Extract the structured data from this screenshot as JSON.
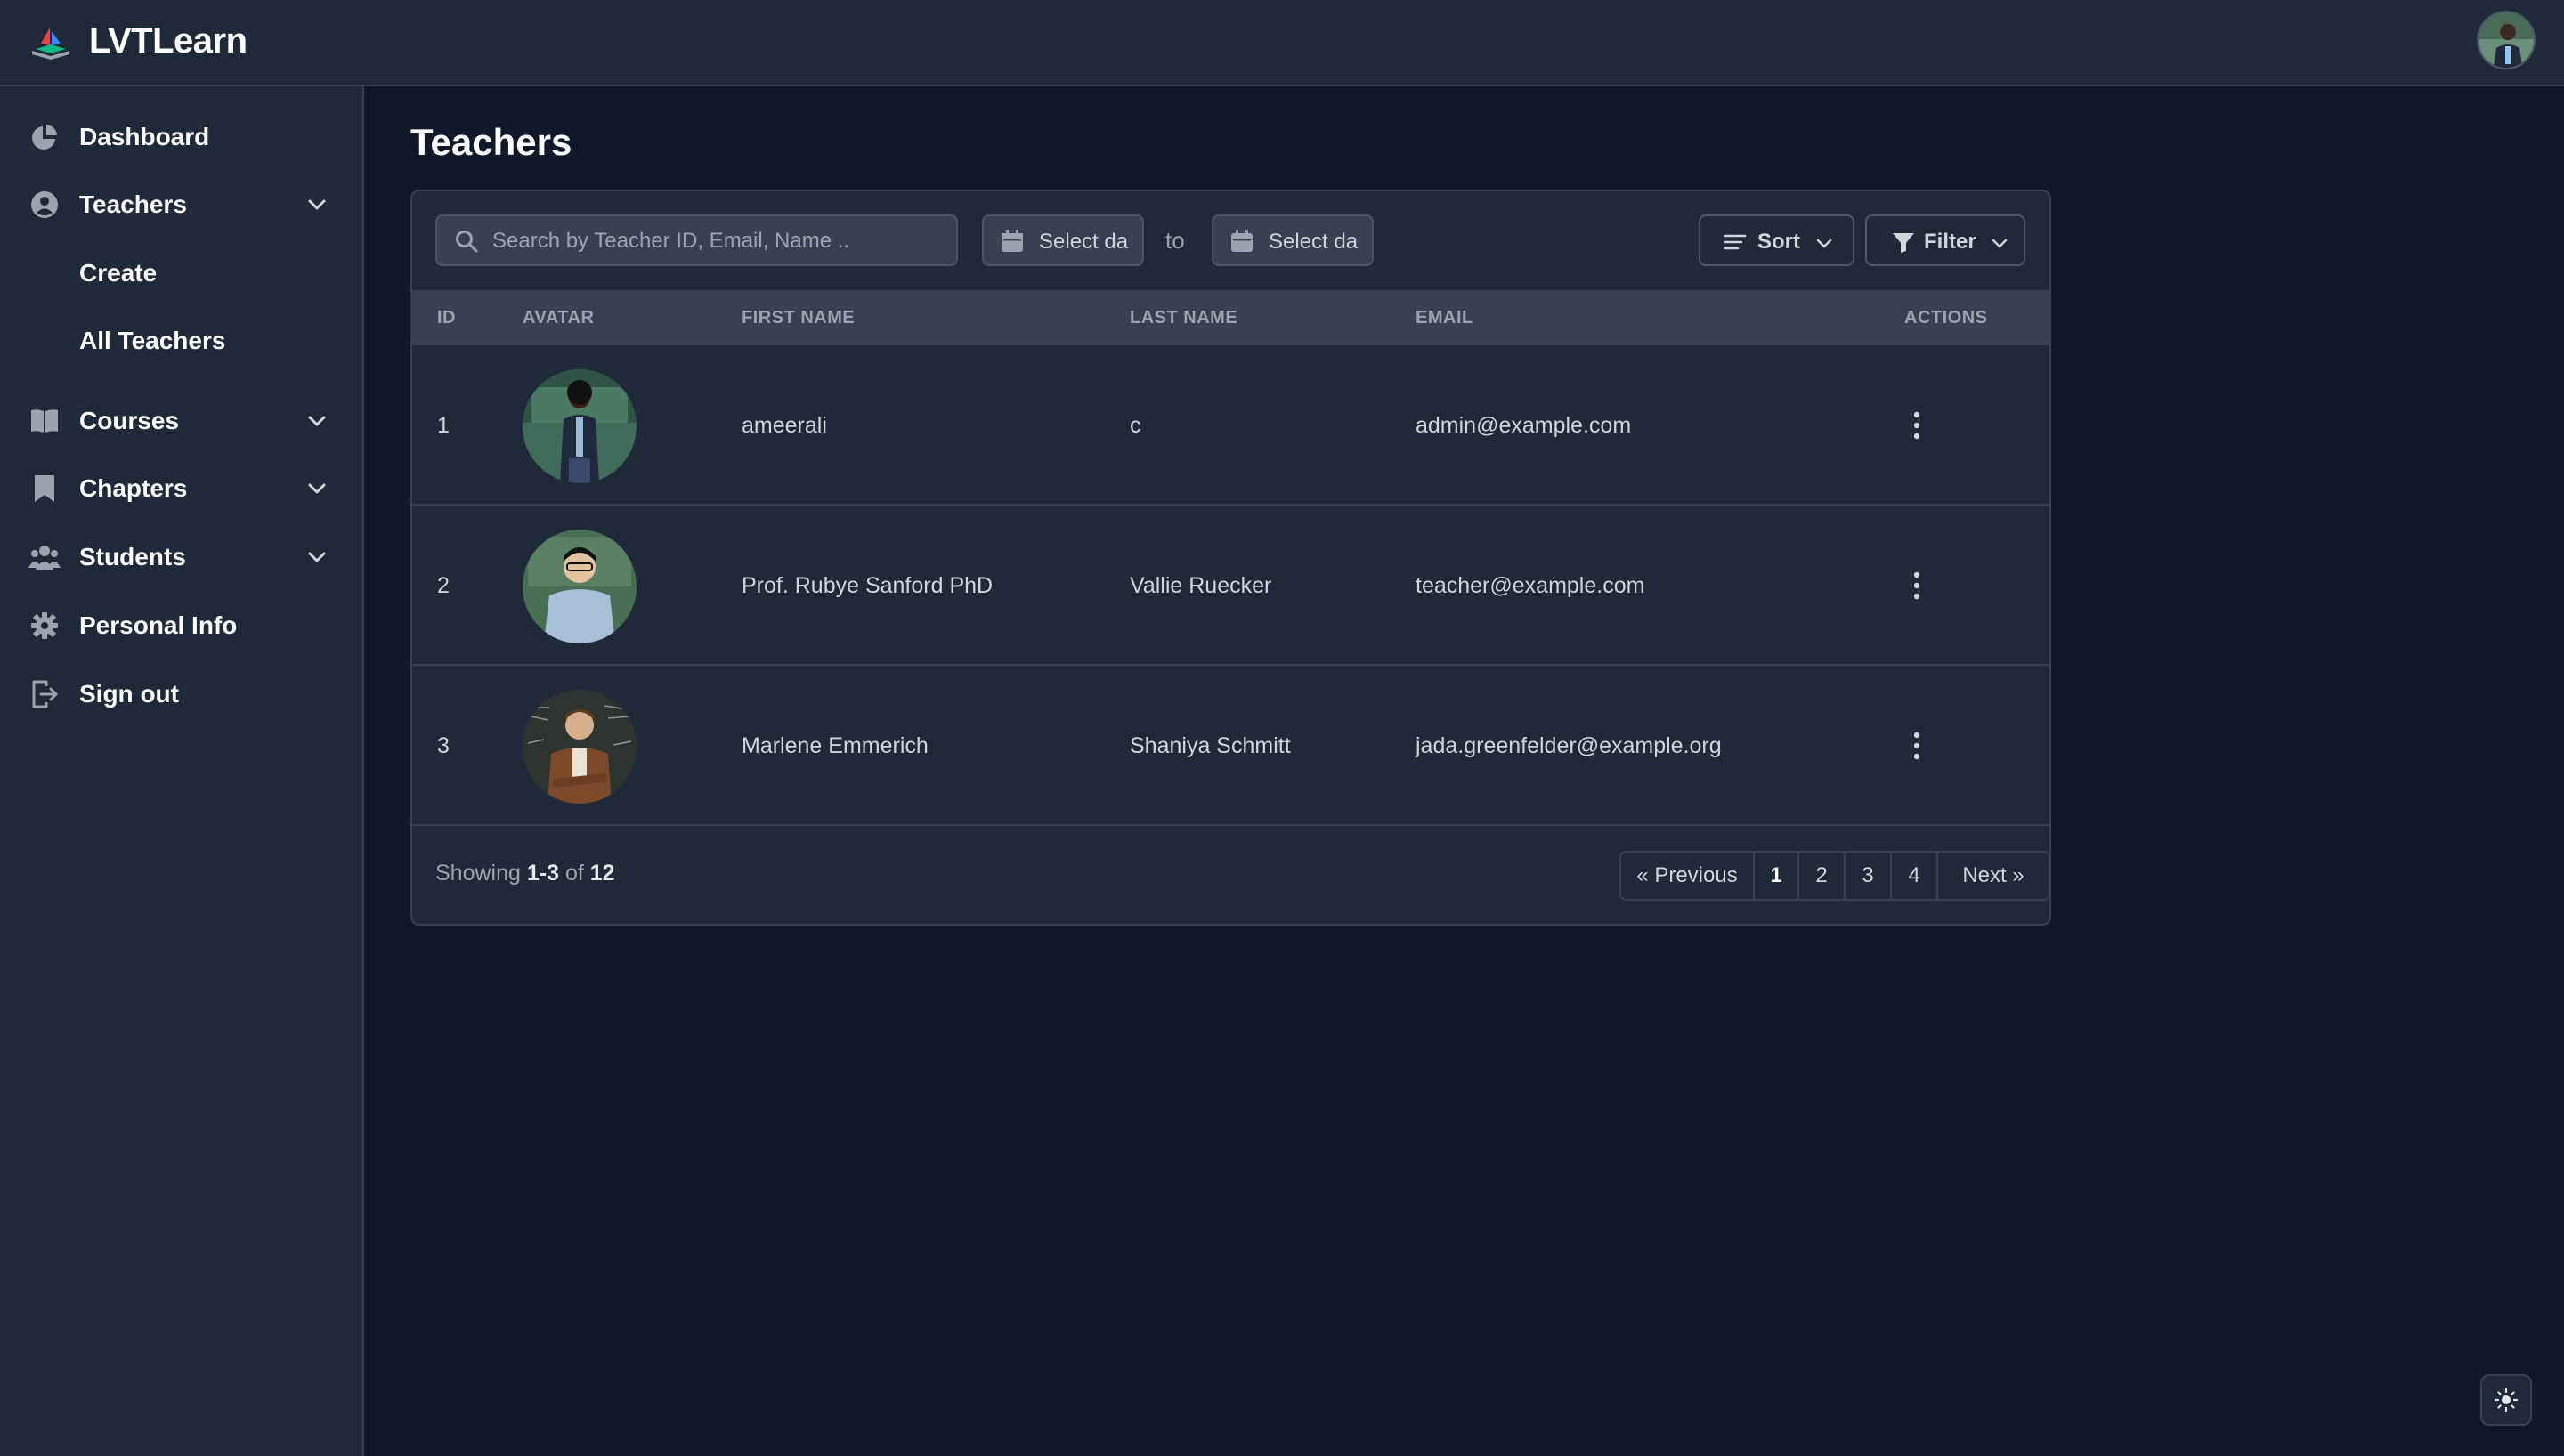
{
  "app": {
    "name": "LVTLearn"
  },
  "sidebar": {
    "items": [
      {
        "label": "Dashboard",
        "icon": "pie-chart-icon"
      },
      {
        "label": "Teachers",
        "icon": "user-circle-icon",
        "expanded": true,
        "children": [
          {
            "label": "Create"
          },
          {
            "label": "All Teachers"
          }
        ]
      },
      {
        "label": "Courses",
        "icon": "book-open-icon"
      },
      {
        "label": "Chapters",
        "icon": "bookmark-icon"
      },
      {
        "label": "Students",
        "icon": "users-icon"
      },
      {
        "label": "Personal Info",
        "icon": "gear-icon"
      },
      {
        "label": "Sign out",
        "icon": "sign-out-icon"
      }
    ]
  },
  "page": {
    "title": "Teachers"
  },
  "toolbar": {
    "search_placeholder": "Search by Teacher ID, Email, Name ..",
    "date_from": "Select da",
    "date_to": "Select da",
    "to_label": "to",
    "sort_label": "Sort",
    "filter_label": "Filter"
  },
  "table": {
    "columns": [
      "ID",
      "AVATAR",
      "FIRST NAME",
      "LAST NAME",
      "EMAIL",
      "ACTIONS"
    ],
    "rows": [
      {
        "id": "1",
        "first_name": "ameerali",
        "last_name": "c",
        "email": "admin@example.com"
      },
      {
        "id": "2",
        "first_name": "Prof. Rubye Sanford PhD",
        "last_name": "Vallie Ruecker",
        "email": "teacher@example.com"
      },
      {
        "id": "3",
        "first_name": "Marlene Emmerich",
        "last_name": "Shaniya Schmitt",
        "email": "jada.greenfelder@example.org"
      }
    ]
  },
  "footer": {
    "showing_prefix": "Showing",
    "range": "1-3",
    "of_label": "of",
    "total": "12"
  },
  "pagination": {
    "previous": "« Previous",
    "pages": [
      "1",
      "2",
      "3",
      "4"
    ],
    "current": "1",
    "next": "Next »"
  },
  "colors": {
    "background": "#111827",
    "panel": "#1f2937",
    "header_row": "#374151"
  }
}
